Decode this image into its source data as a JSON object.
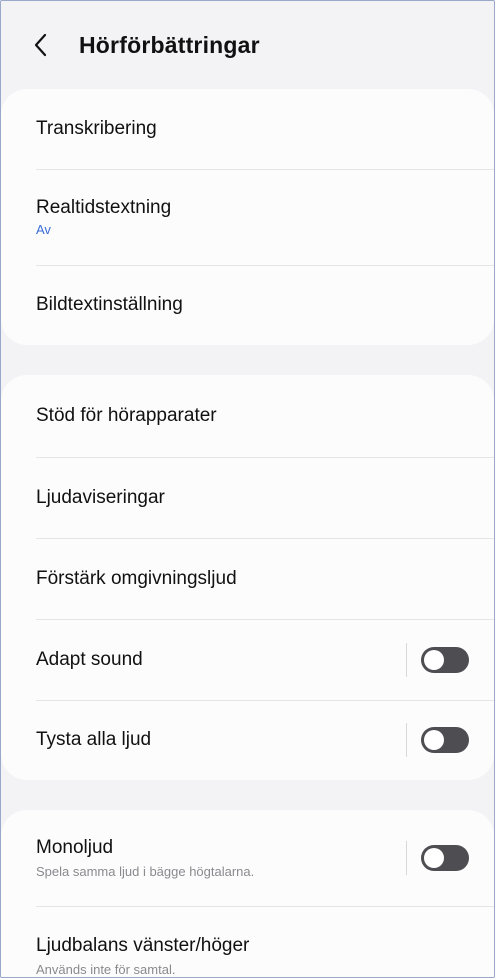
{
  "header": {
    "title": "Hörförbättringar"
  },
  "cards": [
    {
      "items": [
        {
          "label": "Transkribering"
        },
        {
          "label": "Realtidstextning",
          "sub": "Av"
        },
        {
          "label": "Bildtextinställning"
        }
      ]
    },
    {
      "items": [
        {
          "label": "Stöd för hörapparater"
        },
        {
          "label": "Ljudaviseringar"
        },
        {
          "label": "Förstärk omgivningsljud"
        },
        {
          "label": "Adapt sound",
          "toggle": "off"
        },
        {
          "label": "Tysta alla ljud",
          "toggle": "off"
        }
      ]
    },
    {
      "items": [
        {
          "label": "Monoljud",
          "sub": "Spela samma ljud i bägge högtalarna.",
          "toggle": "off"
        },
        {
          "label": "Ljudbalans vänster/höger",
          "sub": "Används inte för samtal."
        }
      ]
    }
  ],
  "colors": {
    "accent": "#3a6cd6",
    "toggle_off": "#4d4d52",
    "background": "#f3f3f5"
  }
}
